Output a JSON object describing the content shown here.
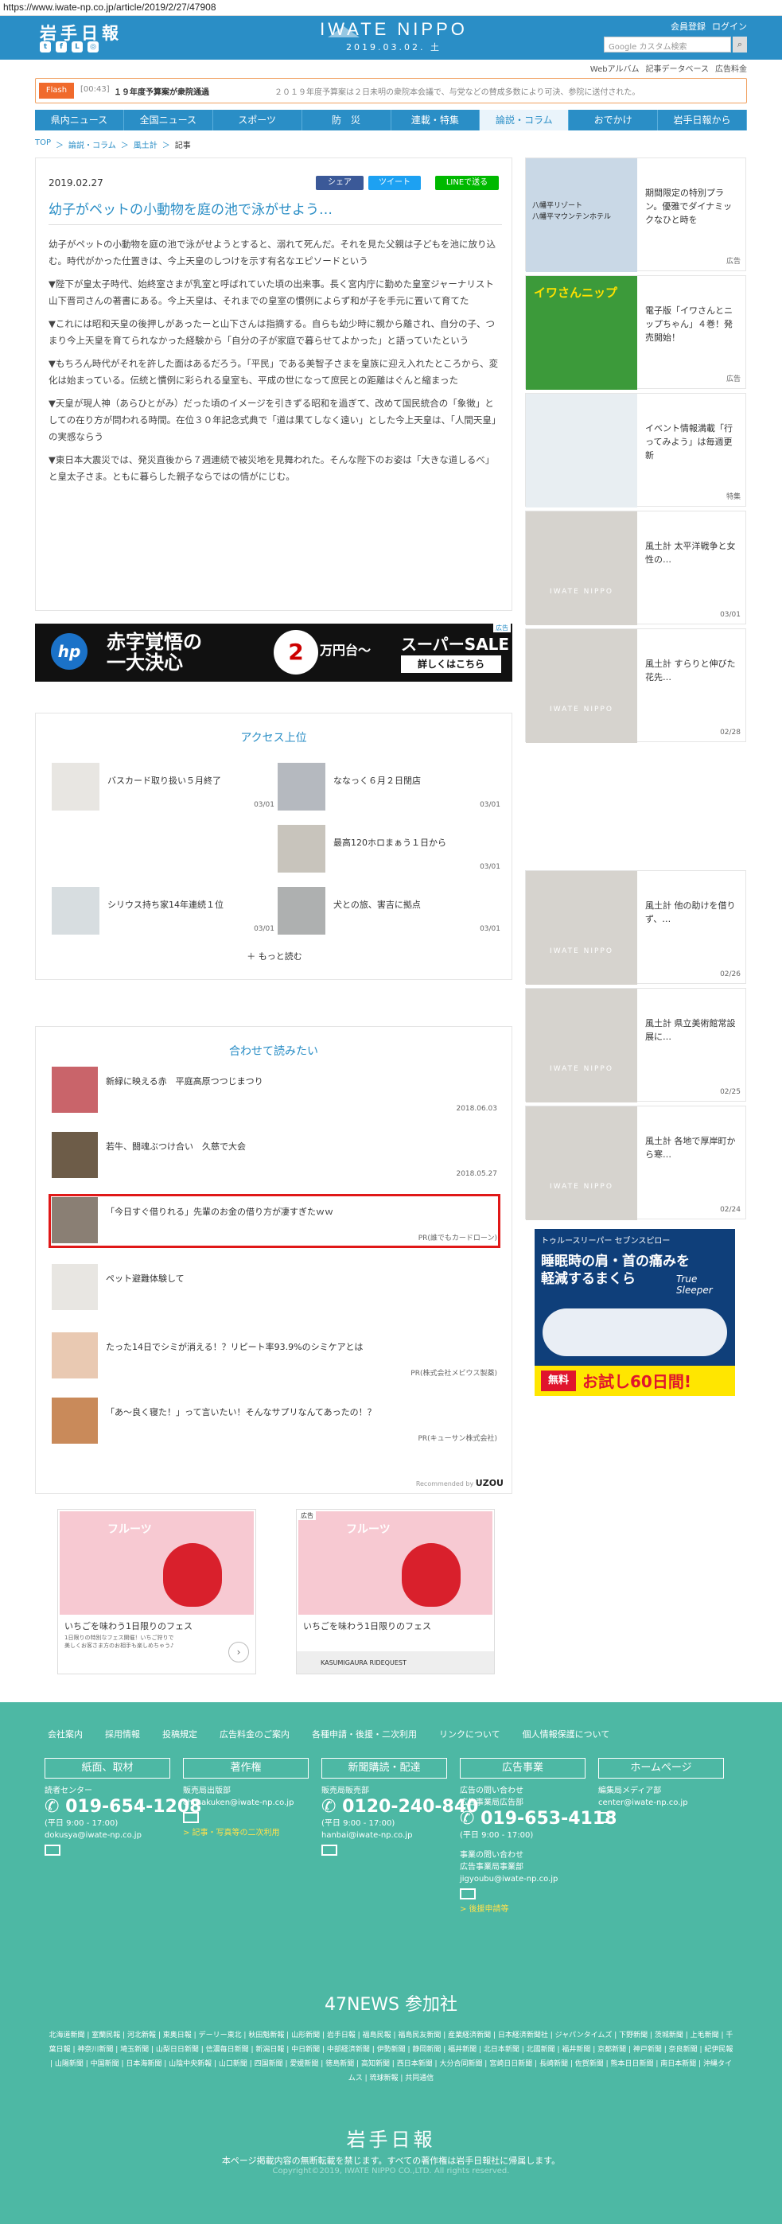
{
  "browser": {
    "url": "https://www.iwate-np.co.jp/article/2019/2/27/47908"
  },
  "header": {
    "logo": "岩手日報",
    "brand": "IWATE NIPPO",
    "date": "2019.03.02. 土",
    "login": "ログイン",
    "register": "会員登録",
    "search_placeholder": "Google カスタム検索"
  },
  "subnav": [
    "Webアルバム",
    "記事データベース",
    "広告料金"
  ],
  "flash": {
    "tag": "Flash",
    "time": "[00:43]",
    "headline": "１９年度予算案が衆院通過",
    "ticker": "２０１９年度予算案は２日未明の衆院本会議で、与党などの賛成多数により可決、参院に送付された。"
  },
  "gnav": [
    "県内ニュース",
    "全国ニュース",
    "スポーツ",
    "防　災",
    "連載・特集",
    "論説・コラム",
    "おでかけ",
    "岩手日報から"
  ],
  "breadcrumb": [
    "TOP",
    "論説・コラム",
    "風土計",
    "記事"
  ],
  "article": {
    "date": "2019.02.27",
    "share": [
      "シェア",
      "ツイート",
      "LINEで送る"
    ],
    "title": "幼子がペットの小動物を庭の池で泳がせよう…",
    "paragraphs": [
      "幼子がペットの小動物を庭の池で泳がせようとすると、溺れて死んだ。それを見た父親は子どもを池に放り込む。時代がかった仕置きは、今上天皇のしつけを示す有名なエピソードという",
      "▼陛下が皇太子時代、始終室さまが乳室と呼ばれていた頃の出来事。長く宮内庁に勤めた皇室ジャーナリスト山下晋司さんの著書にある。今上天皇は、それまでの皇室の慣例によらず和が子を手元に置いて育てた",
      "▼これには昭和天皇の後押しがあったーと山下さんは指摘する。自らも幼少時に親から離され、自分の子、つまり今上天皇を育てられなかった経験から「自分の子が家庭で暮らせてよかった」と語っていたという",
      "▼もちろん時代がそれを許した面はあるだろう。「平民」である美智子さまを皇族に迎え入れたところから、変化は始まっている。伝統と慣例に彩られる皇室も、平成の世になって庶民との距離はぐんと縮まった",
      "▼天皇が現人神（あらひとがみ）だった頃のイメージを引きずる昭和を過ぎて、改めて国民統合の「象徴」としての在り方が問われる時間。在位３０年記念式典で「道は果てしなく遠い」とした今上天皇は、「人間天皇」の実感ならう",
      "▼東日本大震災では、発災直後から７週連続で被災地を見舞われた。そんな陛下のお姿は「大きな道しるべ」と皇太子さま。ともに暮らした親子ならではの情がにじむ。"
    ]
  },
  "ad_banner": {
    "brand": "hp",
    "line1": "赤字覚悟の",
    "line2": "一大決心",
    "amount": "2",
    "unit1": "万",
    "unit2": "円",
    "unit3": "台〜",
    "sale": "スーパーSALE",
    "cta": "詳しくはこちら",
    "label": "広告"
  },
  "ranking": {
    "title": "アクセス上位",
    "items": [
      {
        "title": "バスカード取り扱い５月終了",
        "date": "03/01"
      },
      {
        "title": "ななっく６月２日閉店",
        "date": "03/01"
      },
      {
        "title": "最高120ホロまぁう１日から",
        "date": "03/01"
      },
      {
        "title": "シリウス持ち家14年連続１位",
        "date": "03/01"
      },
      {
        "title": "犬との旅、害吉に拠点",
        "date": "03/01"
      }
    ],
    "more": "もっと読む"
  },
  "related": {
    "title": "合わせて読みたい",
    "items": [
      {
        "title": "新緑に映える赤　平庭高原つつじまつり",
        "meta": "2018.06.03"
      },
      {
        "title": "若牛、闘魂ぶつけ合い　久慈で大会",
        "meta": "2018.05.27"
      },
      {
        "title": "「今日すぐ借りれる」先輩のお金の借り方が凄すぎたｗｗ",
        "meta": "PR(誰でもカードローン)"
      },
      {
        "title": "ペット避難体験して",
        "meta": ""
      },
      {
        "title": "たった14日でシミが消える！？リピート率93.9%のシミケアとは",
        "meta": "PR(株式会社メビウス製薬)"
      },
      {
        "title": "「あ〜良く寝た！」って言いたい！そんなサプリなんてあったの！？",
        "meta": "PR(キューサン株式会社)"
      }
    ],
    "credit_pre": "Recommended by",
    "credit": "UZOU"
  },
  "sidebar": [
    {
      "title": "期間限定の特別プラン。優雅でダイナミックなひと時を",
      "date": "広告",
      "img_label1": "八幡平リゾート",
      "img_label2": "八幡平マウンテンホテル"
    },
    {
      "title": "電子版「イワさんとニップちゃん」４巻！発売開始！",
      "date": "広告",
      "img_label": "イワさんニップ"
    },
    {
      "title": "イベント情報満載「行ってみよう」は毎週更新",
      "date": "特集"
    },
    {
      "title": "風土計 太平洋戦争と女性の…",
      "date": "03/01"
    },
    {
      "title": "風土計 すらりと伸びた花先…",
      "date": "02/28"
    },
    {
      "title": "風土計 他の助けを借りず、…",
      "date": "02/26"
    },
    {
      "title": "風土計 県立美術館常設展に…",
      "date": "02/25"
    },
    {
      "title": "風土計 各地で厚岸町から寒…",
      "date": "02/24"
    }
  ],
  "placeholder_logo": "IWATE NIPPO",
  "big_ad": {
    "brand1": "トゥルースリーパー セブンスピロー",
    "copy1": "睡眠時の肩・首の痛みを",
    "copy2": "軽減するまくら",
    "logo": "True Sleeper",
    "badge": "無料",
    "cta": "お試し60日間!"
  },
  "grid_ads": [
    {
      "label": "",
      "fest": "フルーツ",
      "caption": "いちごを味わう1日限りのフェス",
      "sub1": "1日限りの特別なフェス開催！いちご狩りで",
      "sub2": "美しくお客さま方のお相手も楽しめちゃう♪"
    },
    {
      "label": "広告",
      "fest": "フルーツ",
      "caption": "いちごを味わう1日限りのフェス",
      "sponsor": "KASUMIGAURA RIDEQUEST"
    }
  ],
  "footer": {
    "links": [
      "会社案内",
      "採用情報",
      "投稿規定",
      "広告料金のご案内",
      "各種申請・後援・二次利用",
      "リンクについて",
      "個人情報保護について"
    ],
    "buttons": [
      "紙面、取材",
      "著作権",
      "新聞購読・配達",
      "広告事業",
      "ホームページ"
    ],
    "cols": [
      {
        "head": "読者センター",
        "phone": "019-654-1208",
        "hours": "(平日 9:00 - 17:00)",
        "mail": "dokusya@iwate-np.co.jp"
      },
      {
        "head": "販売局出版部",
        "mail": "chosakuken@iwate-np.co.jp",
        "link": "> 記事・写真等の二次利用"
      },
      {
        "head": "販売局販売部",
        "phone": "0120-240-840",
        "hours": "(平日 9:00 - 17:00)",
        "mail": "hanbai@iwate-np.co.jp"
      },
      {
        "head": "広告の問い合わせ",
        "head2": "広告事業局広告部",
        "phone": "019-653-4118",
        "hours": "(平日 9:00 - 17:00)",
        "head3": "事業の問い合わせ",
        "head4": "広告事業局事業部",
        "mail": "jigyoubu@iwate-np.co.jp",
        "link": "> 後援申請等"
      },
      {
        "head": "編集局メディア部",
        "mail": "center@iwate-np.co.jp"
      }
    ],
    "news_title": "47NEWS 参加社",
    "news": "北海道新聞 | 室蘭民報 | 河北新報 | 東奥日報 | デーリー東北 | 秋田魁新報 | 山形新聞 | 岩手日報 | 福島民報 | 福島民友新聞 | 産業経済新聞 | 日本経済新聞社 | ジャパンタイムズ | 下野新聞 | 茨城新聞 | 上毛新聞 | 千葉日報 | 神奈川新聞 | 埼玉新聞 | 山梨日日新聞 | 信濃毎日新聞 | 新潟日報 | 中日新聞 | 中部経済新聞 | 伊勢新聞 | 静岡新聞 | 福井新聞 | 北日本新聞 | 北國新聞 | 福井新聞 | 京都新聞 | 神戸新聞 | 奈良新聞 | 紀伊民報 | 山陽新聞 | 中国新聞 | 日本海新聞 | 山陰中央新報 | 山口新聞 | 四国新聞 | 愛媛新聞 | 徳島新聞 | 高知新聞 | 西日本新聞 | 大分合同新聞 | 宮崎日日新聞 | 長崎新聞 | 佐賀新聞 | 熊本日日新聞 | 南日本新聞 | 沖縄タイムス | 琉球新報 | 共同通信",
    "logo": "岩手日報",
    "note": "本ページ掲載内容の無断転載を禁じます。すべての著作権は岩手日報社に帰属します。",
    "copyright": "Copyright©2019, IWATE NIPPO CO.,LTD. All rights reserved."
  }
}
